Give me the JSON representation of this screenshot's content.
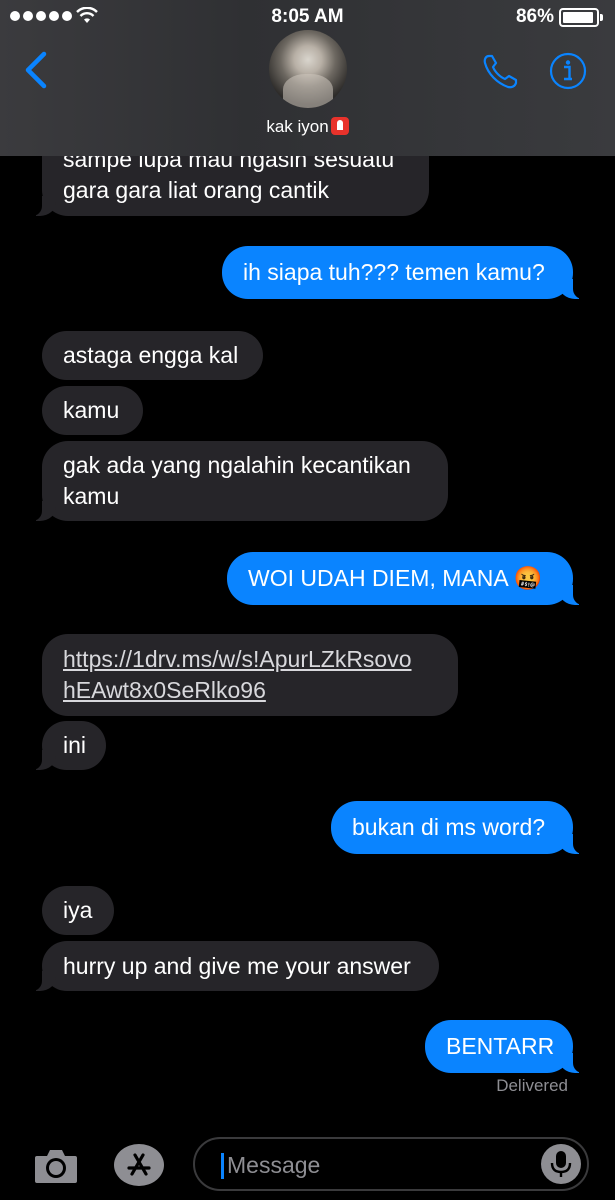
{
  "status_bar": {
    "time": "8:05 AM",
    "battery": "86%"
  },
  "header": {
    "contact_name": "kak iyon",
    "contact_emoji": "police-light-emoji"
  },
  "messages": [
    {
      "side": "received",
      "lines": [
        "sampe lupa mau ngasih sesuatu",
        "gara gara liat orang cantik"
      ]
    },
    {
      "side": "sent",
      "lines": [
        "ih siapa tuh??? temen kamu?"
      ]
    },
    {
      "side": "received",
      "lines": [
        "astaga engga kal"
      ]
    },
    {
      "side": "received",
      "lines": [
        "kamu"
      ]
    },
    {
      "side": "received",
      "lines": [
        "gak ada yang ngalahin kecantikan",
        "kamu"
      ]
    },
    {
      "side": "sent",
      "lines": [
        "WOI UDAH DIEM, MANA 🤬"
      ]
    },
    {
      "side": "received",
      "lines": [
        "https://1drv.ms/w/s!ApurLZkRsovo",
        "hEAwt8x0SeRlko96"
      ]
    },
    {
      "side": "received",
      "lines": [
        "ini"
      ]
    },
    {
      "side": "sent",
      "lines": [
        "bukan di ms word?"
      ]
    },
    {
      "side": "received",
      "lines": [
        "iya"
      ]
    },
    {
      "side": "received",
      "lines": [
        "hurry up and give me your answer"
      ]
    },
    {
      "side": "sent",
      "lines": [
        "BENTARR"
      ]
    }
  ],
  "delivered_label": "Delivered",
  "input": {
    "placeholder": "Message"
  },
  "icons": {
    "back": "chevron-left-icon",
    "phone": "phone-icon",
    "info": "info-icon",
    "camera": "camera-icon",
    "apps": "app-store-icon",
    "mic": "microphone-icon"
  },
  "colors": {
    "sent_bubble": "#0a84ff",
    "received_bubble": "#262529",
    "accent": "#0a84ff"
  }
}
